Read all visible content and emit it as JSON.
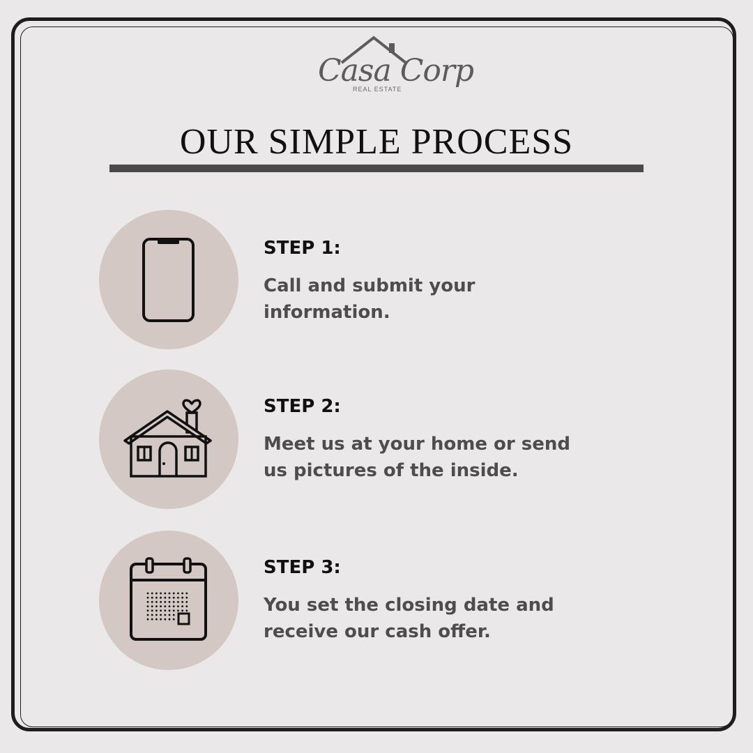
{
  "brand": {
    "name": "Casa Corp",
    "tagline": "REAL ESTATE"
  },
  "title": "OUR SIMPLE PROCESS",
  "colors": {
    "background": "#eae8e8",
    "circle": "#d3c8c4",
    "rule": "#4a4a4a",
    "text_dark": "#111111",
    "text_body": "#4d4d4d"
  },
  "steps": [
    {
      "icon": "smartphone-icon",
      "label": "STEP 1:",
      "description": "Call and submit your information."
    },
    {
      "icon": "house-heart-icon",
      "label": "STEP 2:",
      "description": "Meet us at your home or send us pictures of the inside."
    },
    {
      "icon": "calendar-icon",
      "label": "STEP 3:",
      "description": "You set the closing date and receive our cash offer."
    }
  ]
}
